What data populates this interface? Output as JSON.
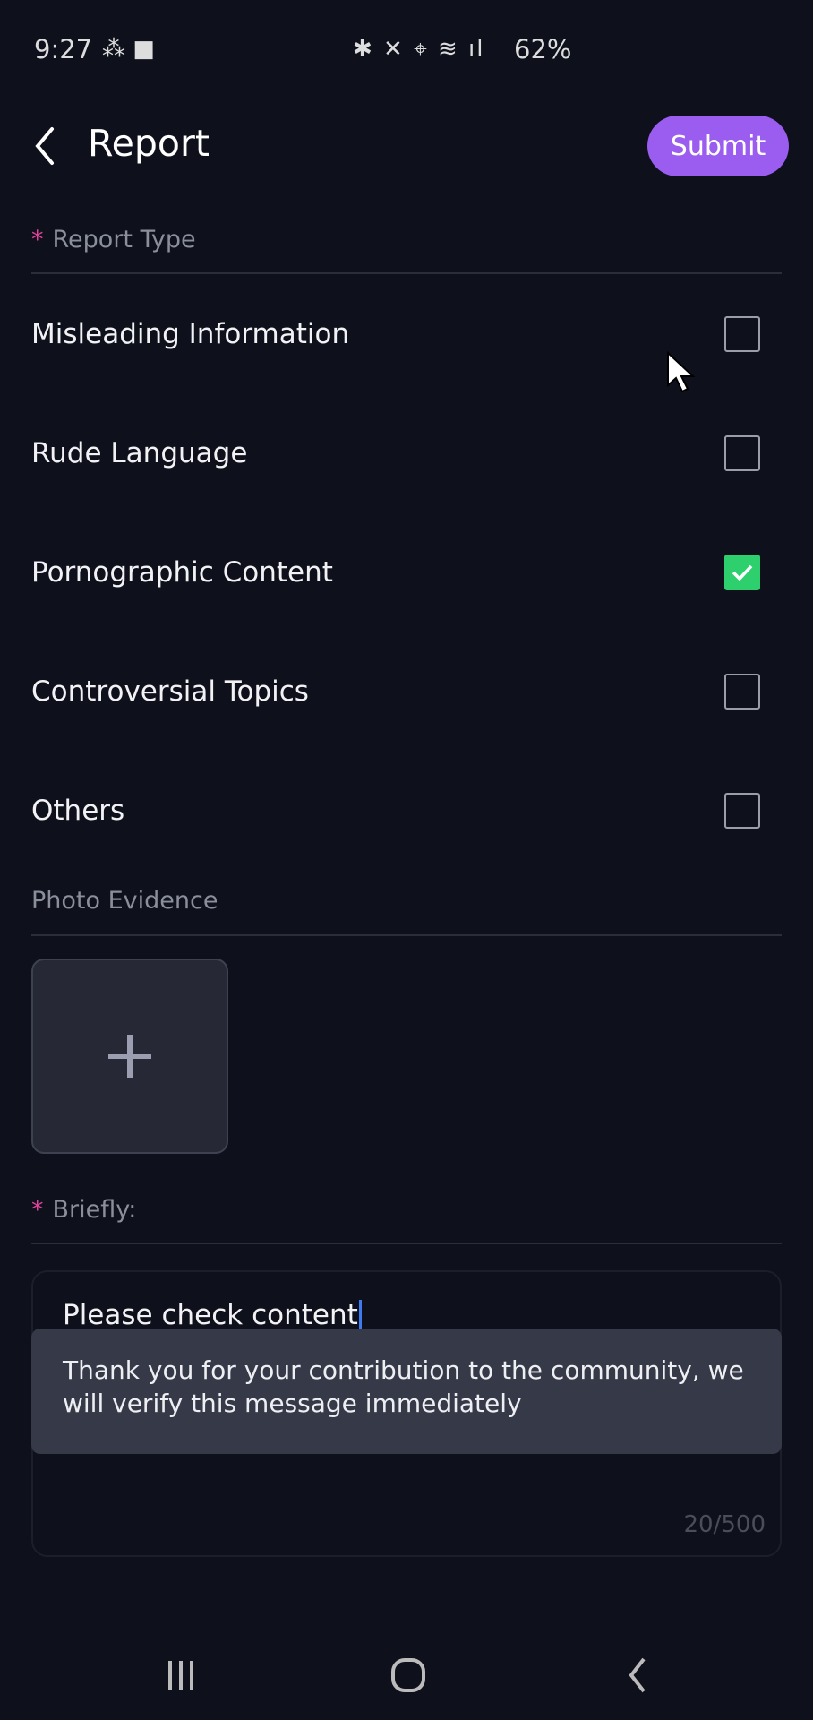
{
  "status_bar": {
    "time": "9:27",
    "battery": "62%"
  },
  "header": {
    "title": "Report",
    "submit_label": "Submit"
  },
  "report_type": {
    "label": "Report Type",
    "required_mark": "*",
    "options": [
      {
        "label": "Misleading Information",
        "checked": false
      },
      {
        "label": "Rude Language",
        "checked": false
      },
      {
        "label": "Pornographic Content",
        "checked": true
      },
      {
        "label": "Controversial Topics",
        "checked": false
      },
      {
        "label": "Others",
        "checked": false
      }
    ]
  },
  "photo": {
    "label": "Photo Evidence"
  },
  "briefly": {
    "label": "Briefly:",
    "required_mark": "*",
    "value": "Please check content",
    "counter": "20/500"
  },
  "toast": {
    "message": "Thank you for your contribution to the community, we will verify this message immediately"
  },
  "colors": {
    "accent": "#9b5cf0",
    "checked": "#2ed06e",
    "required": "#e0449a",
    "background": "#0e111c"
  }
}
